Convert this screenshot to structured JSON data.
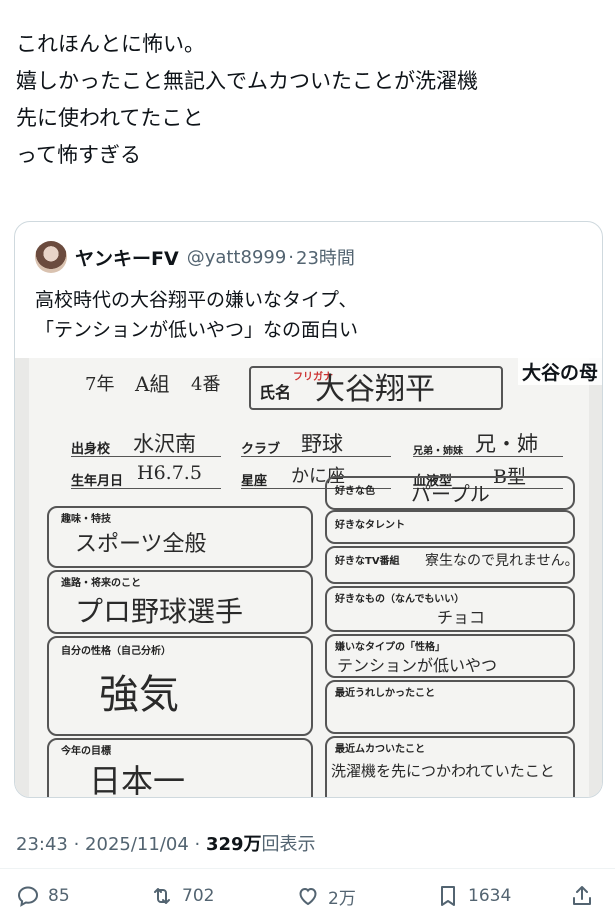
{
  "post": {
    "lines": [
      "これほんとに怖い。",
      "嬉しかったこと無記入でムカついたことが洗濯機",
      "先に使われてたこと",
      "って怖すぎる"
    ]
  },
  "quote": {
    "display_name": "ヤンキーFV",
    "handle": "@yatt8999",
    "time": "23時間",
    "lines": [
      "高校時代の大谷翔平の嫌いなタイプ、",
      "「テンションが低いやつ」なの面白い"
    ],
    "image": {
      "caption": "大谷の母",
      "header": {
        "grade": "7年",
        "class": "A組",
        "number": "4番",
        "furigana_label": "フリガナ",
        "name_label": "氏名",
        "name": "大谷翔平"
      },
      "fields": {
        "school_label": "出身校",
        "school": "水沢南",
        "club_label": "クラブ",
        "club": "野球",
        "siblings_label": "兄弟・姉妹",
        "siblings": "兄・姉",
        "birthday_label": "生年月日",
        "birthday": "H6.7.5",
        "star_label": "星座",
        "star": "かに座",
        "blood_label": "血液型",
        "blood": "B型"
      },
      "boxes": {
        "hobby_label": "趣味・特技",
        "hobby": "スポーツ全般",
        "future_label": "進路・将来のこと",
        "future": "プロ野球選手",
        "character_label": "自分の性格（自己分析）",
        "character": "強気",
        "goal_label": "今年の目標",
        "goal": "日本一",
        "color_label": "好きな色",
        "color": "パープル",
        "talent_label": "好きなタレント",
        "talent": "",
        "tv_label": "好きなTV番組",
        "tv": "寮生なので見れません。",
        "thing_label": "好きなもの（なんでもいい）",
        "thing": "チョコ",
        "dislike_label": "嫌いなタイプの「性格」",
        "dislike": "テンションが低いやつ",
        "happy_label": "最近うれしかったこと",
        "happy": "",
        "angry_label": "最近ムカついたこと",
        "angry": "洗濯機を先につかわれていたこと"
      }
    }
  },
  "meta": {
    "time_date": "23:43 · 2025/11/04 · ",
    "views_count": "329万",
    "views_suffix": "回表示"
  },
  "actions": {
    "replies": "85",
    "reposts": "702",
    "likes": "2万",
    "bookmarks": "1634"
  }
}
